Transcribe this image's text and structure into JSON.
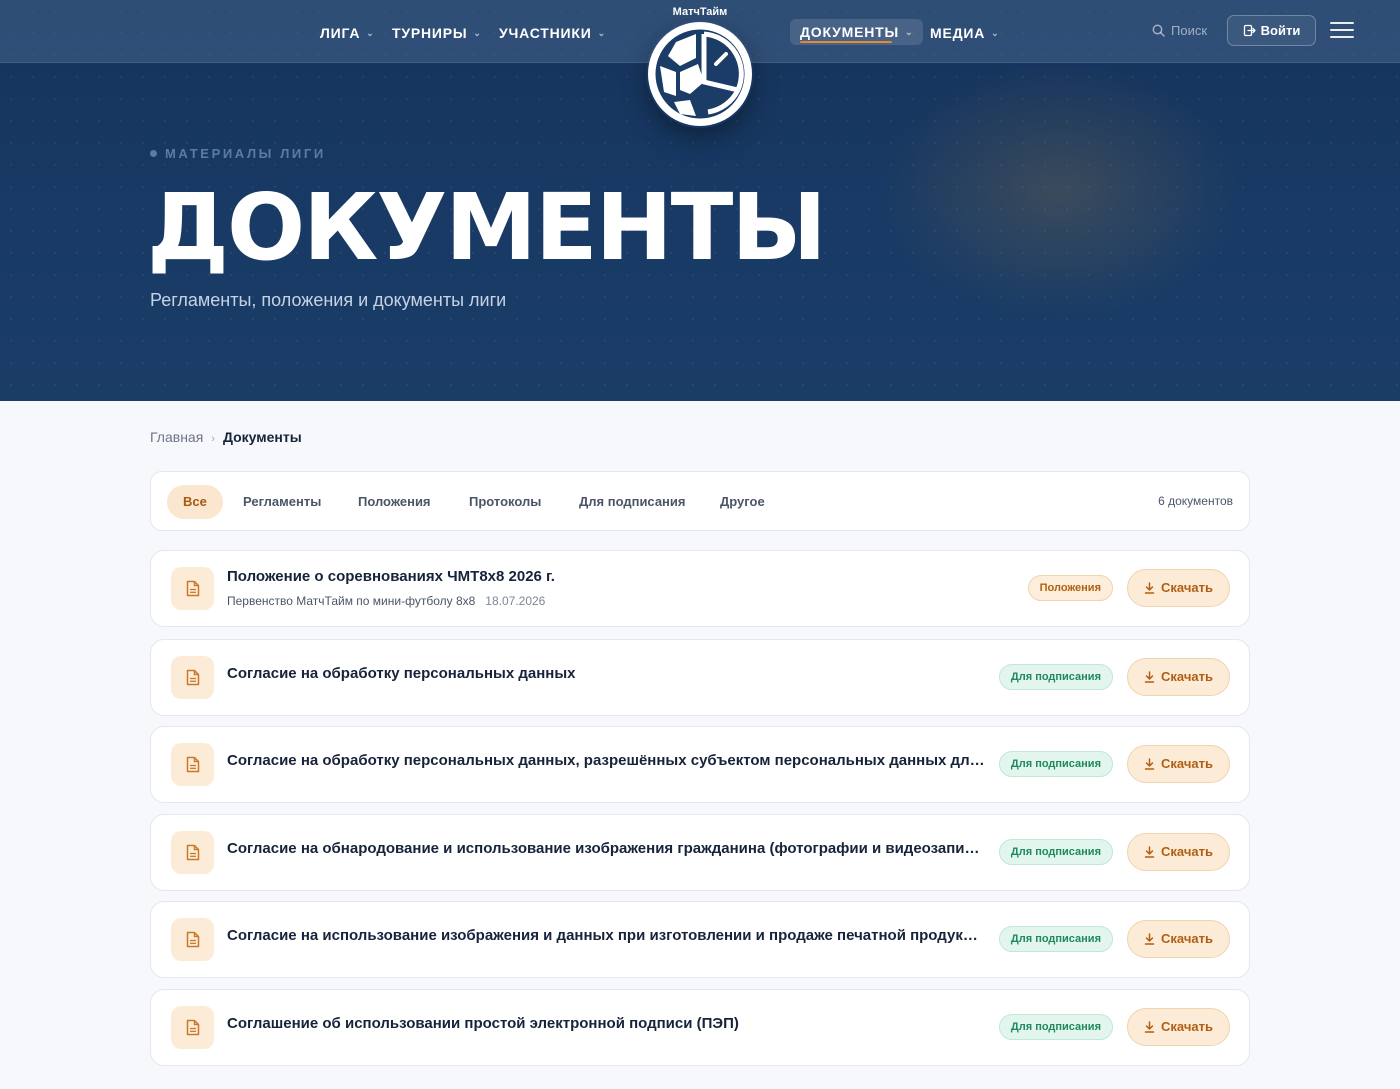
{
  "brand": {
    "name": "МатчТайм"
  },
  "nav": {
    "left": [
      {
        "label": "ЛИГА"
      },
      {
        "label": "ТУРНИРЫ"
      },
      {
        "label": "УЧАСТНИКИ"
      }
    ],
    "right": [
      {
        "label": "ДОКУМЕНТЫ",
        "active": true
      },
      {
        "label": "МЕДИА"
      }
    ],
    "search_label": "Поиск",
    "login_label": "Войти"
  },
  "hero": {
    "eyebrow": "МАТЕРИАЛЫ ЛИГИ",
    "title": "ДОКУМЕНТЫ",
    "subtitle": "Регламенты, положения и документы лиги"
  },
  "breadcrumb": {
    "home": "Главная",
    "current": "Документы"
  },
  "filters": {
    "tabs": [
      {
        "label": "Все",
        "active": true
      },
      {
        "label": "Регламенты"
      },
      {
        "label": "Положения"
      },
      {
        "label": "Протоколы"
      },
      {
        "label": "Для подписания"
      },
      {
        "label": "Другое"
      }
    ],
    "count_label": "6 документов"
  },
  "download_label": "Скачать",
  "documents": [
    {
      "title": "Положение о соревнованиях ЧМТ8х8 2026 г.",
      "subtitle": "Первенство МатчТайм по мини-футболу 8х8",
      "date": "18.07.2026",
      "badge": "Положения"
    },
    {
      "title": "Согласие на обработку персональных данных",
      "badge": "Для подписания"
    },
    {
      "title": "Согласие на обработку персональных данных, разрешённых субъектом персональных данных для распространения",
      "badge": "Для подписания"
    },
    {
      "title": "Согласие на обнародование и использование изображения гражданина (фотографии и видеозаписи)",
      "badge": "Для подписания"
    },
    {
      "title": "Согласие на использование изображения и данных при изготовлении и продаже печатной продукции",
      "badge": "Для подписания"
    },
    {
      "title": "Соглашение об использовании простой электронной подписи (ПЭП)",
      "badge": "Для подписания"
    }
  ],
  "colors": {
    "accent": "#e38a2c",
    "hero_bg": "#183a65",
    "sign_badge": "#1f8a5c",
    "pol_badge": "#b1610f"
  }
}
